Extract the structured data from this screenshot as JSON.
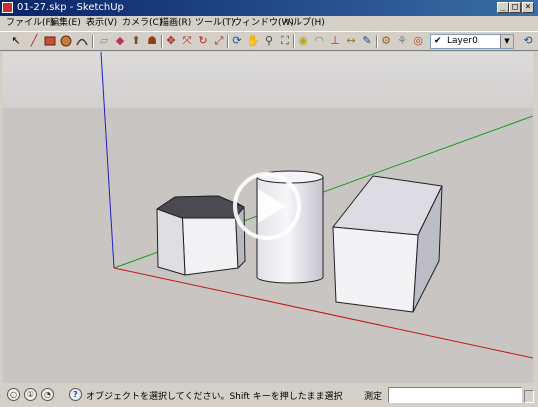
{
  "window": {
    "title": "01-27.skp - SketchUp"
  },
  "titlebar": {
    "minimize": "_",
    "maximize": "□",
    "close": "×"
  },
  "menubar": [
    "ファイル(F)",
    "編集(E)",
    "表示(V)",
    "カメラ(C)",
    "描画(R)",
    "ツール(T)",
    "ウィンドウ(W)",
    "ヘルプ(H)"
  ],
  "toolbar": {
    "tools": [
      "select-icon",
      "pencil-line-icon",
      "rectangle-icon",
      "circle-icon",
      "arc-icon",
      "eraser-icon",
      "paint-bucket-icon",
      "push-pull-icon",
      "follow-me-icon",
      "move-icon",
      "offset-icon",
      "rotate-icon",
      "scale-icon",
      "orbit-icon",
      "pan-icon",
      "zoom-icon",
      "zoom-extents-icon",
      "tape-measure-icon",
      "protractor-icon",
      "axes-icon",
      "dimension-icon",
      "text-icon",
      "3d-text-icon",
      "walk-icon",
      "look-around-icon",
      "position-camera-icon"
    ],
    "layer": {
      "check": "✔",
      "name": "Layer0"
    }
  },
  "viewport": {
    "colors": {
      "sky": "#d8d6d5",
      "ground": "#c9c5c3",
      "red_axis": "#c01818",
      "green_axis": "#1b9a1b",
      "blue_axis": "#2020c8",
      "face_light": "#f2f2f4",
      "face_mid": "#d9d9de",
      "face_dark": "#b5b5bc"
    },
    "objects": [
      "hexagonal-prism",
      "cylinder",
      "box"
    ],
    "play_overlay": "play-icon"
  },
  "statusbar": {
    "icons": [
      "geolocation-icon",
      "credits-icon",
      "user-icon",
      "help-icon"
    ],
    "hint": "オブジェクトを選択してください。Shift キーを押したまま選択",
    "measure_label": "測定",
    "measure_value": ""
  }
}
